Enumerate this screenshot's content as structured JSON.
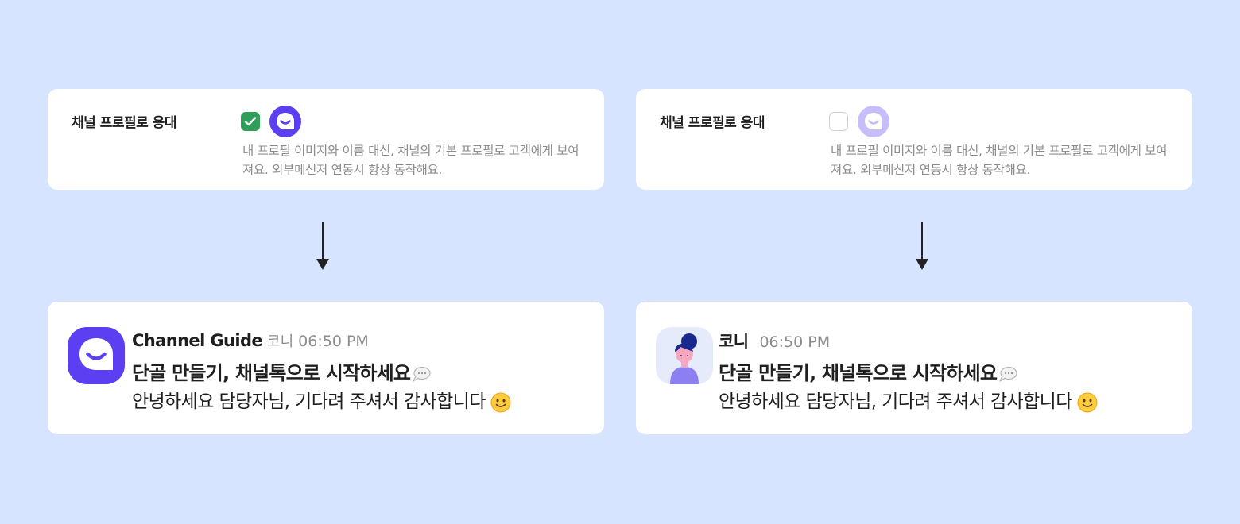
{
  "left_panel": {
    "setting": {
      "label": "채널 프로필로 응대",
      "checked": true,
      "icon": "channel-talk-logo-icon",
      "description": "내 프로필 이미지와 이름 대신, 채널의 기본 프로필로 고객에게 보여져요. 외부메신저 연동시 항상 동작해요."
    },
    "message": {
      "avatar_icon": "channel-talk-logo-icon",
      "sender": "Channel Guide",
      "sender_tag": "코니",
      "time": "06:50 PM",
      "title": "단골 만들기, 채널톡으로 시작하세요",
      "body": "안녕하세요 담당자님, 기다려 주셔서 감사합니다"
    }
  },
  "right_panel": {
    "setting": {
      "label": "채널 프로필로 응대",
      "checked": false,
      "icon": "channel-talk-logo-icon",
      "description": "내 프로필 이미지와 이름 대신, 채널의 기본 프로필로 고객에게 보여져요. 외부메신저 연동시 항상 동작해요."
    },
    "message": {
      "avatar_icon": "person-avatar-icon",
      "sender": "코니",
      "time": "06:50 PM",
      "title": "단골 만들기, 채널톡으로 시작하세요",
      "body": "안녕하세요 담당자님, 기다려 주셔서 감사합니다"
    }
  },
  "colors": {
    "background": "#d6e4ff",
    "brand": "#5b3ff0",
    "brand_disabled": "#c7bdfa",
    "check_green": "#2f9e5a",
    "muted_text": "#8c8c8c"
  }
}
